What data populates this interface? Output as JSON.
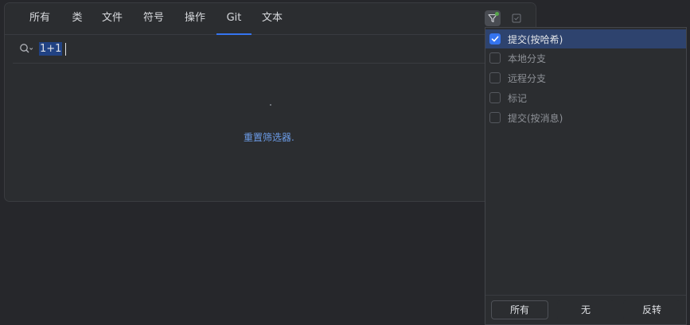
{
  "tabs": [
    {
      "label": "所有"
    },
    {
      "label": "类"
    },
    {
      "label": "文件"
    },
    {
      "label": "符号"
    },
    {
      "label": "操作"
    },
    {
      "label": "Git",
      "active": true
    },
    {
      "label": "文本"
    }
  ],
  "search": {
    "query": "1+1"
  },
  "results": {
    "reset_link": "重置筛选器."
  },
  "filter_popup": {
    "options": [
      {
        "label": "提交(按哈希)",
        "checked": true
      },
      {
        "label": "本地分支",
        "checked": false
      },
      {
        "label": "远程分支",
        "checked": false
      },
      {
        "label": "标记",
        "checked": false
      },
      {
        "label": "提交(按消息)",
        "checked": false
      }
    ],
    "footer": {
      "all_label": "所有",
      "none_label": "无",
      "invert_label": "反转"
    }
  },
  "colors": {
    "accent": "#3574f0",
    "link": "#6c9ce8",
    "filter_active_dot": "#57a64a"
  },
  "icons": {
    "filter": "funnel-icon",
    "scope": "checkbox-scope-icon",
    "search": "magnifier-icon"
  }
}
